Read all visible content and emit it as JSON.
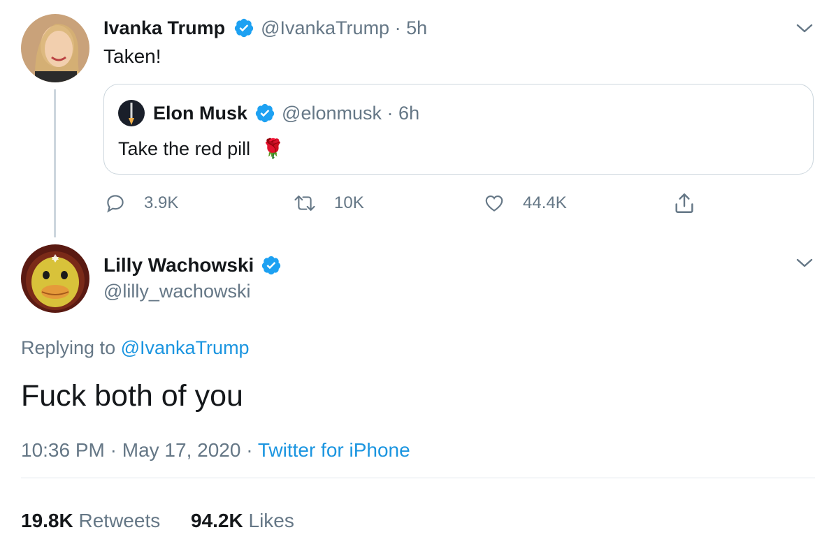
{
  "colors": {
    "link": "#1b95e0",
    "muted": "#657786",
    "verified": "#1da1f2",
    "border": "#ccd6dd"
  },
  "parent_tweet": {
    "author_name": "Ivanka Trump",
    "handle": "@IvankaTrump",
    "time": "5h",
    "text": "Taken!",
    "menu_icon": "chevron-down-icon",
    "quoted_tweet": {
      "author_name": "Elon Musk",
      "handle": "@elonmusk",
      "time": "6h",
      "text": "Take the red pill",
      "emoji": "🌹"
    },
    "actions": {
      "replies": "3.9K",
      "retweets": "10K",
      "likes": "44.4K",
      "share_icon": "share-icon"
    }
  },
  "main_tweet": {
    "author_name": "Lilly Wachowski",
    "handle": "@lilly_wachowski",
    "replying_to_prefix": "Replying to",
    "replying_to_handle": "@IvankaTrump",
    "text": "Fuck both of you",
    "time": "10:36 PM",
    "date": "May 17, 2020",
    "source": "Twitter for iPhone",
    "retweets_count": "19.8K",
    "retweets_label": "Retweets",
    "likes_count": "94.2K",
    "likes_label": "Likes",
    "menu_icon": "chevron-down-icon"
  },
  "separator": "·"
}
